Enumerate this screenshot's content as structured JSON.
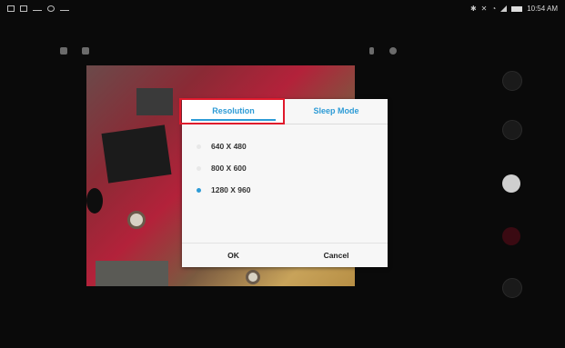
{
  "status_bar": {
    "time": "10:54 AM",
    "left_icons": [
      "screenshot-icon",
      "sd-card-icon",
      "cast-icon",
      "settings-icon",
      "minus-icon"
    ],
    "right_icons": [
      "bluetooth-icon",
      "mute-icon",
      "wifi-icon",
      "signal-icon",
      "battery-icon"
    ]
  },
  "colors": {
    "accent": "#2d9bd6",
    "highlight": "#e0192c",
    "background": "#0a0a0a"
  },
  "dialog": {
    "tabs": [
      {
        "label": "Resolution",
        "selected": true
      },
      {
        "label": "Sleep Mode",
        "selected": false
      }
    ],
    "options": [
      {
        "label": "640 X 480",
        "selected": false
      },
      {
        "label": "800 X 600",
        "selected": false
      },
      {
        "label": "1280 X 960",
        "selected": true
      }
    ],
    "ok_label": "OK",
    "cancel_label": "Cancel"
  }
}
